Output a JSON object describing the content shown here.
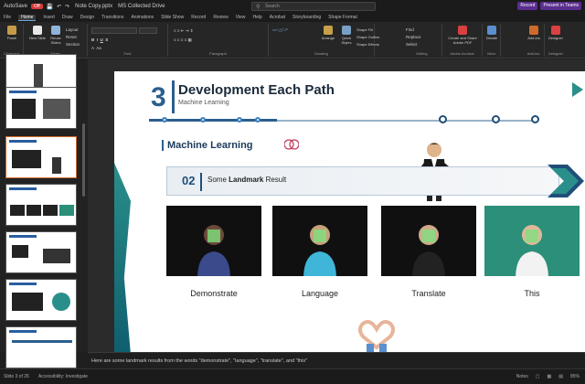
{
  "titlebar": {
    "autosave_label": "AutoSave",
    "autosave_state": "Off",
    "file_name": "Note Copy.pptx",
    "save_location": "MS Collected Drive",
    "search_placeholder": "Search",
    "right_buttons": [
      "Record",
      "Present in Teams"
    ]
  },
  "tabs": [
    "File",
    "Home",
    "Insert",
    "Draw",
    "Design",
    "Transitions",
    "Animations",
    "Slide Show",
    "Record",
    "Review",
    "View",
    "Help",
    "Acrobat",
    "Storyboarding",
    "Shape Format"
  ],
  "ribbon": {
    "groups": [
      "Clipboard",
      "Slides",
      "Font",
      "Paragraph",
      "Drawing",
      "Editing",
      "Adobe Acrobat",
      "Voice",
      "Add-ins",
      "Designer"
    ],
    "buttons": [
      "Paste",
      "New Slide",
      "Reuse Slides",
      "Layout",
      "Reset",
      "Section",
      "Arrange",
      "Quick Styles",
      "Shape Fill",
      "Shape Outline",
      "Shape Effects",
      "Find",
      "Replace",
      "Select",
      "Create and Share Adobe PDF",
      "Dictate",
      "Add-ins",
      "Designer"
    ]
  },
  "slide": {
    "number": "3",
    "title": "Development Each Path",
    "subtitle": "Machine Learning",
    "section_label": "Machine Learning",
    "banner_number": "02",
    "banner_text_pre": "Some ",
    "banner_text_bold": "Landmark",
    "banner_text_post": " Result",
    "photos": [
      {
        "caption": "Demonstrate",
        "shirt": "#3a4a8a",
        "bg": "#0d0d0d"
      },
      {
        "caption": "Language",
        "shirt": "#3fb6d8",
        "bg": "#0d0d0d"
      },
      {
        "caption": "Translate",
        "shirt": "#222222",
        "bg": "#0d0d0d"
      },
      {
        "caption": "This",
        "shirt": "#f2f2f2",
        "bg": "#2c8f79"
      }
    ]
  },
  "notes": "Here are some landmark results from the words \"demonstrate\", \"language\", \"translate\", and \"this\"",
  "status": {
    "slide_info": "Slide 3 of 26",
    "accessibility": "Accessibility: Investigate",
    "notes_label": "Notes",
    "zoom": "85%"
  },
  "colors": {
    "accent": "#2b5f8e",
    "teal": "#2a8f8a",
    "ribbon_bg": "#262626"
  }
}
